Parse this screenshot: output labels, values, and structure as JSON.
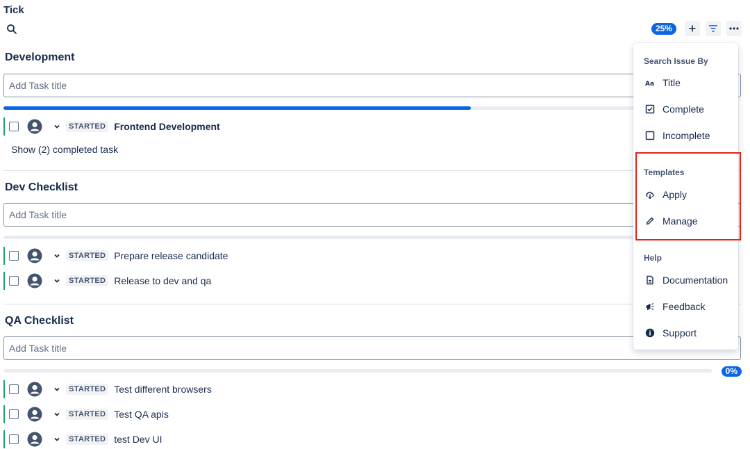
{
  "app": {
    "title": "Tick"
  },
  "toolbar": {
    "progress": "25%"
  },
  "sections": [
    {
      "title": "Development",
      "input_placeholder": "Add Task title",
      "progress_fraction": 0.66,
      "tasks": [
        {
          "status": "STARTED",
          "title": "Frontend Development"
        }
      ],
      "show_completed": "Show (2) completed task"
    },
    {
      "title": "Dev Checklist",
      "input_placeholder": "Add Task title",
      "progress_fraction": 0.0,
      "tasks": [
        {
          "status": "STARTED",
          "title": "Prepare release candidate"
        },
        {
          "status": "STARTED",
          "title": "Release to dev and qa"
        }
      ]
    },
    {
      "title": "QA Checklist",
      "input_placeholder": "Add Task title",
      "progress_fraction": 0.0,
      "progress_label": "0%",
      "tasks": [
        {
          "status": "STARTED",
          "title": "Test different browsers"
        },
        {
          "status": "STARTED",
          "title": "Test QA apis"
        },
        {
          "status": "STARTED",
          "title": "test Dev UI"
        }
      ]
    }
  ],
  "menu": {
    "search_heading": "Search Issue By",
    "search_items": [
      {
        "label": "Title",
        "icon": "text-case-icon"
      },
      {
        "label": "Complete",
        "icon": "checkbox-checked-icon"
      },
      {
        "label": "Incomplete",
        "icon": "checkbox-empty-icon"
      }
    ],
    "templates_heading": "Templates",
    "template_items": [
      {
        "label": "Apply",
        "icon": "cloud-download-icon"
      },
      {
        "label": "Manage",
        "icon": "pencil-icon"
      }
    ],
    "help_heading": "Help",
    "help_items": [
      {
        "label": "Documentation",
        "icon": "document-icon"
      },
      {
        "label": "Feedback",
        "icon": "megaphone-icon"
      },
      {
        "label": "Support",
        "icon": "info-icon"
      }
    ]
  },
  "colors": {
    "accent": "#0c66e4",
    "status_bar": "#22a06b",
    "highlight": "#e2231a"
  }
}
